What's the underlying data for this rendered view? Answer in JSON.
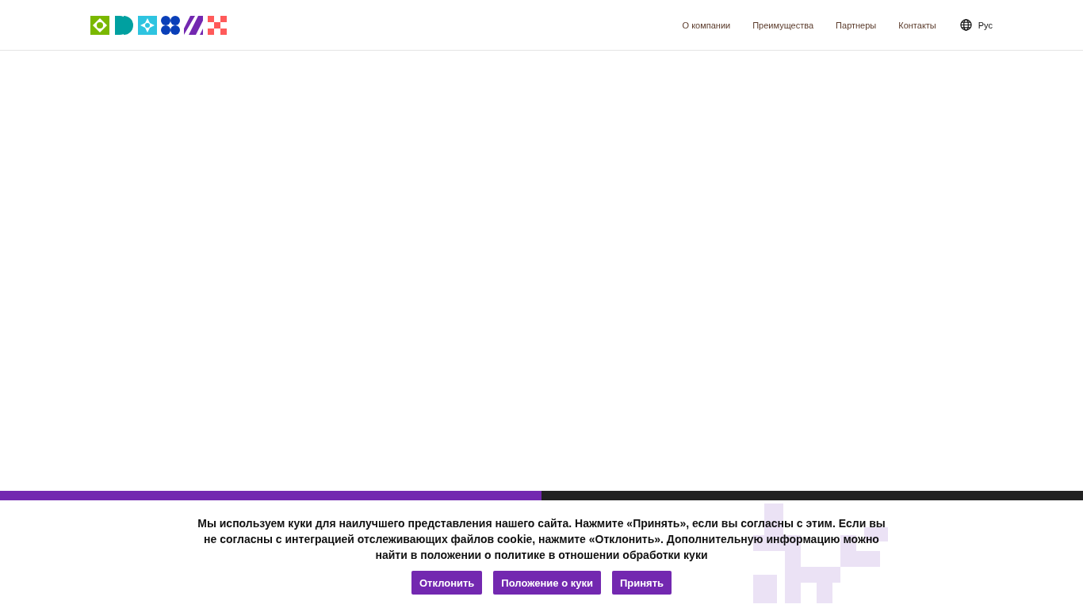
{
  "header": {
    "nav": [
      "О компании",
      "Преимущества",
      "Партнеры",
      "Контакты"
    ],
    "language": "Рус"
  },
  "cookie_banner": {
    "text": "Мы используем куки для наилучшего представления нашего сайта. Нажмите «Принять», если вы согласны с этим. Если вы не согласны с интеграцией отслеживающих файлов cookie, нажмите «Отклонить». Дополнительную информацию можно найти в положении о политике в отношении обработки куки",
    "buttons": [
      "Отклонить",
      "Положение о куки",
      "Принять"
    ]
  }
}
